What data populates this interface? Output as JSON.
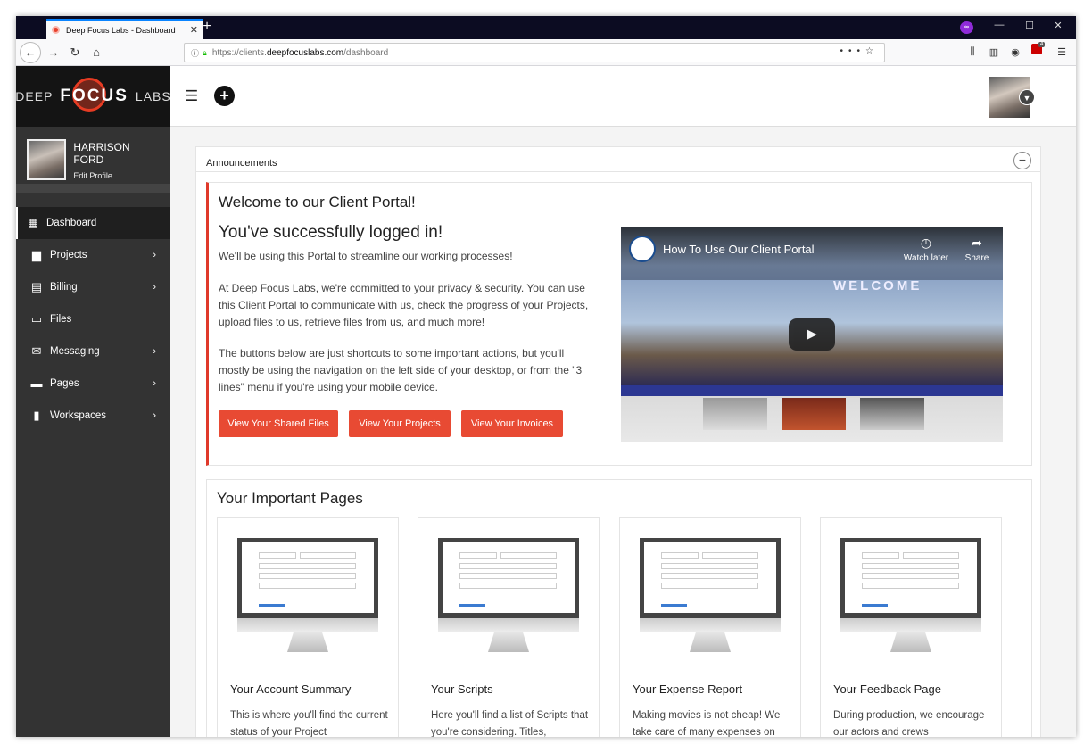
{
  "browser": {
    "tab_title": "Deep Focus Labs - Dashboard",
    "url_pre": "https://clients.",
    "url_host": "deepfocuslabs.com",
    "url_post": "/dashboard",
    "addon_badge": "4"
  },
  "logo": {
    "left": "DEEP",
    "center": "FOCUS",
    "right": "LABS"
  },
  "user": {
    "name": "HARRISON FORD",
    "edit": "Edit Profile"
  },
  "sidebar": {
    "items": [
      {
        "label": "Dashboard",
        "icon": "dashboard-icon"
      },
      {
        "label": "Projects",
        "icon": "briefcase-icon"
      },
      {
        "label": "Billing",
        "icon": "building-icon"
      },
      {
        "label": "Files",
        "icon": "folder-icon"
      },
      {
        "label": "Messaging",
        "icon": "envelope-icon"
      },
      {
        "label": "Pages",
        "icon": "pages-icon"
      },
      {
        "label": "Workspaces",
        "icon": "book-icon"
      }
    ]
  },
  "announcements": {
    "header": "Announcements",
    "title": "Welcome to our Client Portal!",
    "subtitle": "You've successfully logged in!",
    "p1": "We'll be using this Portal to streamline our working processes!",
    "p2": "At Deep Focus Labs, we're committed to your privacy & security. You can use this Client Portal to communicate with us, check the progress of your Projects, upload files to us, retrieve files from us, and much more!",
    "p3": "The buttons below are just shortcuts to some important actions, but you'll mostly be using the navigation on the left side of your desktop, or from the \"3 lines\" menu if you're using your mobile device.",
    "buttons": [
      "View Your Shared Files",
      "View Your Projects",
      "View Your Invoices"
    ]
  },
  "video": {
    "title": "How To Use Our Client Portal",
    "watch_later": "Watch later",
    "share": "Share",
    "welcome": "WELCOME"
  },
  "important": {
    "title": "Your Important Pages",
    "cards": [
      {
        "title": "Your Account Summary",
        "desc": "This is where you'll find the current status of your Project"
      },
      {
        "title": "Your Scripts",
        "desc": "Here you'll find a list of Scripts that you're considering. Titles,"
      },
      {
        "title": "Your Expense Report",
        "desc": "Making movies is not cheap! We take care of many expenses on"
      },
      {
        "title": "Your Feedback Page",
        "desc": "During production, we encourage our actors and crews"
      }
    ]
  },
  "colors": {
    "accent": "#e84a33",
    "sidebar": "#333333"
  }
}
